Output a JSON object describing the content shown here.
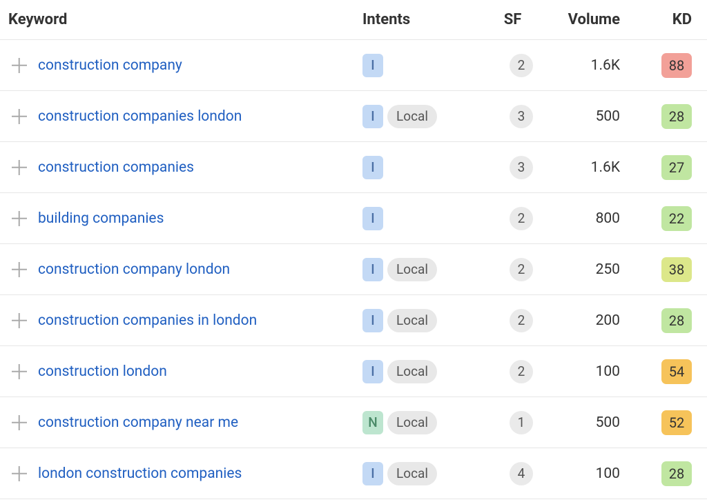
{
  "columns": {
    "keyword": "Keyword",
    "intents": "Intents",
    "sf": "SF",
    "volume": "Volume",
    "kd": "KD"
  },
  "intent_labels": {
    "I": "I",
    "N": "N"
  },
  "local_label": "Local",
  "rows": [
    {
      "keyword": "construction company",
      "intent": "I",
      "local": false,
      "sf": "2",
      "volume": "1.6K",
      "kd": "88",
      "kd_color": "red"
    },
    {
      "keyword": "construction companies london",
      "intent": "I",
      "local": true,
      "sf": "3",
      "volume": "500",
      "kd": "28",
      "kd_color": "green"
    },
    {
      "keyword": "construction companies",
      "intent": "I",
      "local": false,
      "sf": "3",
      "volume": "1.6K",
      "kd": "27",
      "kd_color": "green"
    },
    {
      "keyword": "building companies",
      "intent": "I",
      "local": false,
      "sf": "2",
      "volume": "800",
      "kd": "22",
      "kd_color": "green"
    },
    {
      "keyword": "construction company london",
      "intent": "I",
      "local": true,
      "sf": "2",
      "volume": "250",
      "kd": "38",
      "kd_color": "lime"
    },
    {
      "keyword": "construction companies in london",
      "intent": "I",
      "local": true,
      "sf": "2",
      "volume": "200",
      "kd": "28",
      "kd_color": "green"
    },
    {
      "keyword": "construction london",
      "intent": "I",
      "local": true,
      "sf": "2",
      "volume": "100",
      "kd": "54",
      "kd_color": "orange"
    },
    {
      "keyword": "construction company near me",
      "intent": "N",
      "local": true,
      "sf": "1",
      "volume": "500",
      "kd": "52",
      "kd_color": "orange"
    },
    {
      "keyword": "london construction companies",
      "intent": "I",
      "local": true,
      "sf": "4",
      "volume": "100",
      "kd": "28",
      "kd_color": "green"
    }
  ]
}
